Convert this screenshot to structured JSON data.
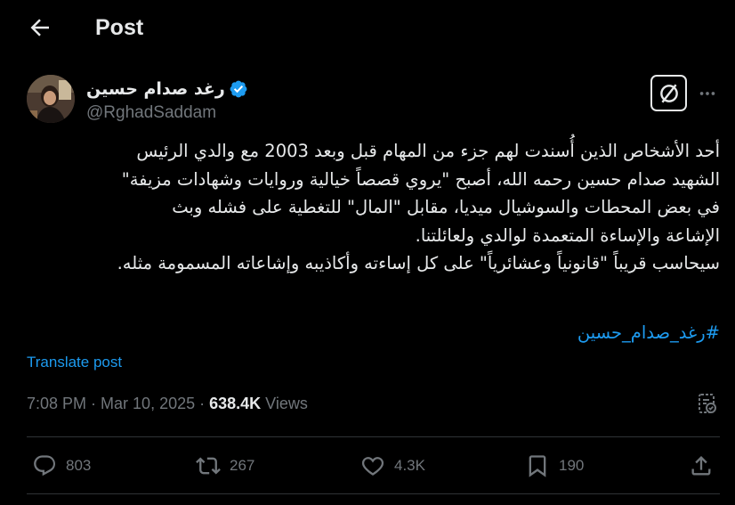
{
  "header": {
    "title": "Post"
  },
  "author": {
    "display_name": "رغد صدام حسين",
    "handle": "@RghadSaddam",
    "verified": true
  },
  "post": {
    "lines": [
      "أحد الأشخاص الذين أُسندت لهم جزء من المهام قبل وبعد 2003 مع والدي الرئيس",
      "الشهيد صدام حسين رحمه الله، أصبح \"يروي قصصاً خيالية وروايات وشهادات مزيفة\"",
      "في بعض المحطات والسوشيال ميديا، مقابل \"المال\" للتغطية على فشله وبث",
      "الإشاعة والإساءة المتعمدة لوالدي ولعائلتنا.",
      "سيحاسب قريباً \"قانونياً وعشائرياً\" على كل إساءته وأكاذيبه وإشاعاته المسمومة مثله."
    ],
    "hashtag": "#رغد_صدام_حسين",
    "translate_label": "Translate post",
    "time": "7:08 PM",
    "date": "Mar 10, 2025",
    "separator": "·",
    "views_count": "638.4K",
    "views_label": "Views"
  },
  "actions": {
    "replies": "803",
    "reposts": "267",
    "likes": "4.3K",
    "bookmarks": "190"
  },
  "colors": {
    "background": "#000000",
    "text": "#e7e9ea",
    "muted": "#71767b",
    "accent": "#1d9bf0",
    "divider": "#2f3336"
  },
  "icons": {
    "back": "arrow-left-icon",
    "verified": "verified-badge-icon",
    "grok": "grok-icon",
    "more": "more-dots-icon",
    "analytics": "analytics-icon",
    "reply": "reply-icon",
    "repost": "repost-icon",
    "like": "heart-icon",
    "bookmark": "bookmark-icon",
    "share": "share-icon"
  }
}
